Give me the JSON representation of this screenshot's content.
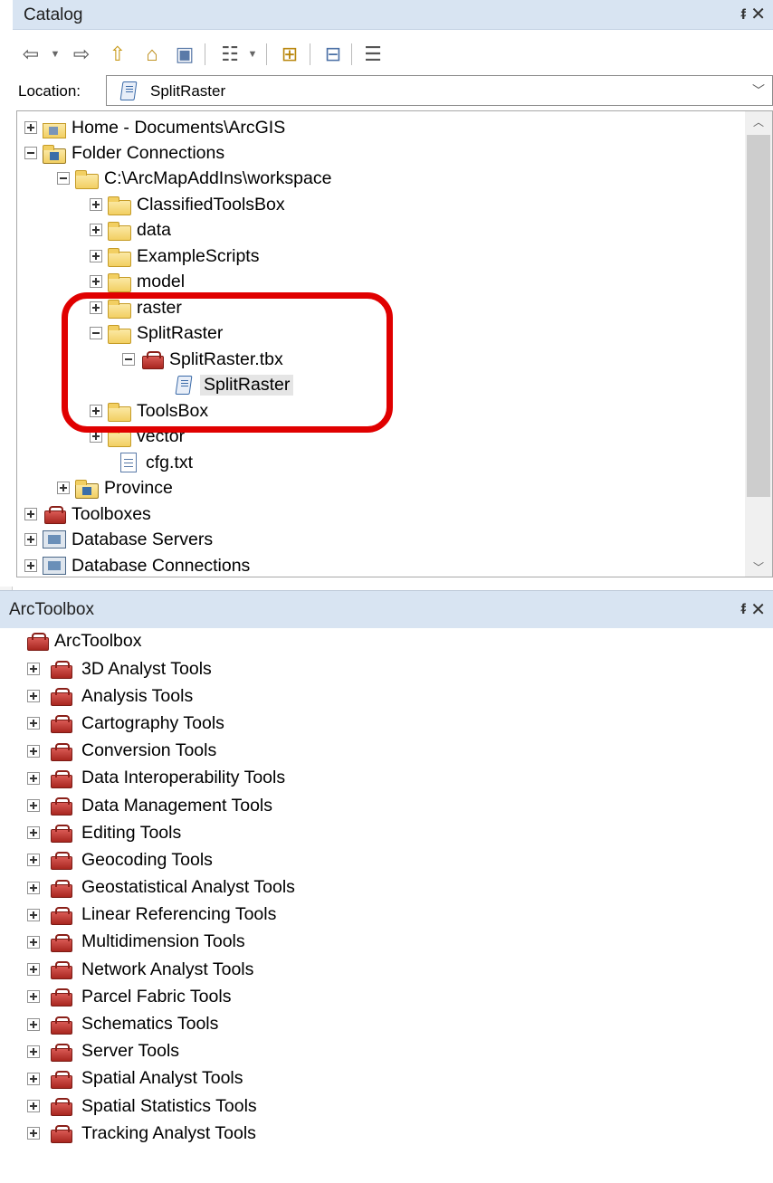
{
  "catalog": {
    "title": "Catalog",
    "pin": "ᵮ",
    "close": "✕",
    "location_label": "Location:",
    "location_value": "SplitRaster",
    "tree": [
      {
        "label": "Home - Documents\\ArcGIS",
        "expander": "plus",
        "icon": "home-folder-icon"
      },
      {
        "label": "Folder Connections",
        "expander": "minus",
        "icon": "folder-connections-icon"
      },
      {
        "label": "C:\\ArcMapAddIns\\workspace",
        "expander": "minus",
        "icon": "folder-icon"
      },
      {
        "label": "ClassifiedToolsBox",
        "expander": "plus",
        "icon": "folder-icon"
      },
      {
        "label": "data",
        "expander": "plus",
        "icon": "folder-icon"
      },
      {
        "label": "ExampleScripts",
        "expander": "plus",
        "icon": "folder-icon"
      },
      {
        "label": "model",
        "expander": "plus",
        "icon": "folder-icon"
      },
      {
        "label": "raster",
        "expander": "plus",
        "icon": "folder-icon"
      },
      {
        "label": "SplitRaster",
        "expander": "minus",
        "icon": "folder-icon"
      },
      {
        "label": "SplitRaster.tbx",
        "expander": "minus",
        "icon": "toolbox-icon"
      },
      {
        "label": "SplitRaster",
        "expander": "none",
        "icon": "script-tool-icon",
        "selected": true
      },
      {
        "label": "ToolsBox",
        "expander": "plus",
        "icon": "folder-icon"
      },
      {
        "label": "vector",
        "expander": "plus",
        "icon": "folder-icon"
      },
      {
        "label": "cfg.txt",
        "expander": "none",
        "icon": "text-file-icon"
      },
      {
        "label": "Province",
        "expander": "plus",
        "icon": "folder-icon"
      },
      {
        "label": "Toolboxes",
        "expander": "plus",
        "icon": "toolboxes-icon"
      },
      {
        "label": "Database Servers",
        "expander": "plus",
        "icon": "database-server-icon"
      },
      {
        "label": "Database Connections",
        "expander": "plus",
        "icon": "database-connection-icon"
      }
    ]
  },
  "arctoolbox": {
    "title": "ArcToolbox",
    "pin": "ᵮ",
    "close": "✕",
    "root_label": "ArcToolbox",
    "items": [
      "3D Analyst Tools",
      "Analysis Tools",
      "Cartography Tools",
      "Conversion Tools",
      "Data Interoperability Tools",
      "Data Management Tools",
      "Editing Tools",
      "Geocoding Tools",
      "Geostatistical Analyst Tools",
      "Linear Referencing Tools",
      "Multidimension Tools",
      "Network Analyst Tools",
      "Parcel Fabric Tools",
      "Schematics Tools",
      "Server Tools",
      "Spatial Analyst Tools",
      "Spatial Statistics Tools",
      "Tracking Analyst Tools"
    ]
  },
  "colors": {
    "title_bar": "#d8e4f2",
    "highlight": "#e00000",
    "folder": "#f2cf62",
    "toolbox": "#c0392b"
  }
}
